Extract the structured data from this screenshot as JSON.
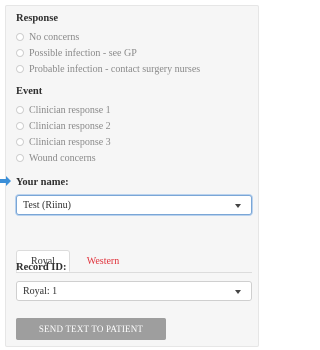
{
  "response": {
    "title": "Response",
    "options": [
      "No concerns",
      "Possible infection - see GP",
      "Probable infection - contact surgery nurses"
    ]
  },
  "event": {
    "title": "Event",
    "options": [
      "Clinician response 1",
      "Clinician response 2",
      "Clinician response 3",
      "Wound concerns"
    ]
  },
  "your_name": {
    "label": "Your name:",
    "value": "Test (Riinu)"
  },
  "tabs": {
    "active": "Royal",
    "inactive": "Western"
  },
  "record": {
    "label": "Record ID:",
    "value": "Royal: 1"
  },
  "send_button": {
    "label": "SEND TEXT TO PATIENT"
  },
  "colors": {
    "accent_red": "#e0313a",
    "arrow_blue": "#3b8fd8"
  },
  "icons": {
    "pointer": "arrow-right-icon",
    "dropdown": "chevron-down-icon"
  }
}
